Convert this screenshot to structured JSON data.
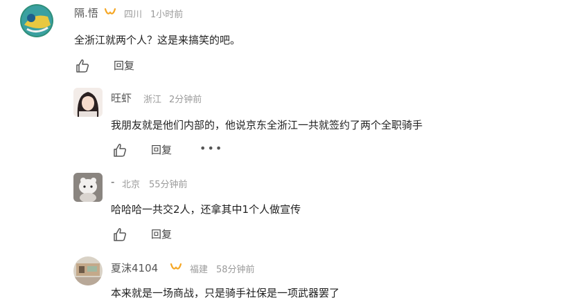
{
  "comments": [
    {
      "user": "隔.悟",
      "location": "四川",
      "time": "1小时前",
      "text": "全浙江就两个人？这是来搞笑的吧。",
      "reply_label": "回复",
      "badge_color": "#f5a623",
      "replies": [
        {
          "user": "旺虾",
          "location": "浙江",
          "time": "2分钟前",
          "text": "我朋友就是他们内部的，他说京东全浙江一共就签约了两个全职骑手",
          "reply_label": "回复",
          "more_label": "•••"
        },
        {
          "user": "-",
          "location": "北京",
          "time": "55分钟前",
          "text": "哈哈哈一共交2人，还拿其中1个人做宣传",
          "reply_label": "回复"
        },
        {
          "user": "夏沫4104",
          "location": "福建",
          "time": "58分钟前",
          "text": "本来就是一场商战，只是骑手社保是一项武器罢了",
          "badge_color": "#f5a623"
        }
      ]
    }
  ]
}
